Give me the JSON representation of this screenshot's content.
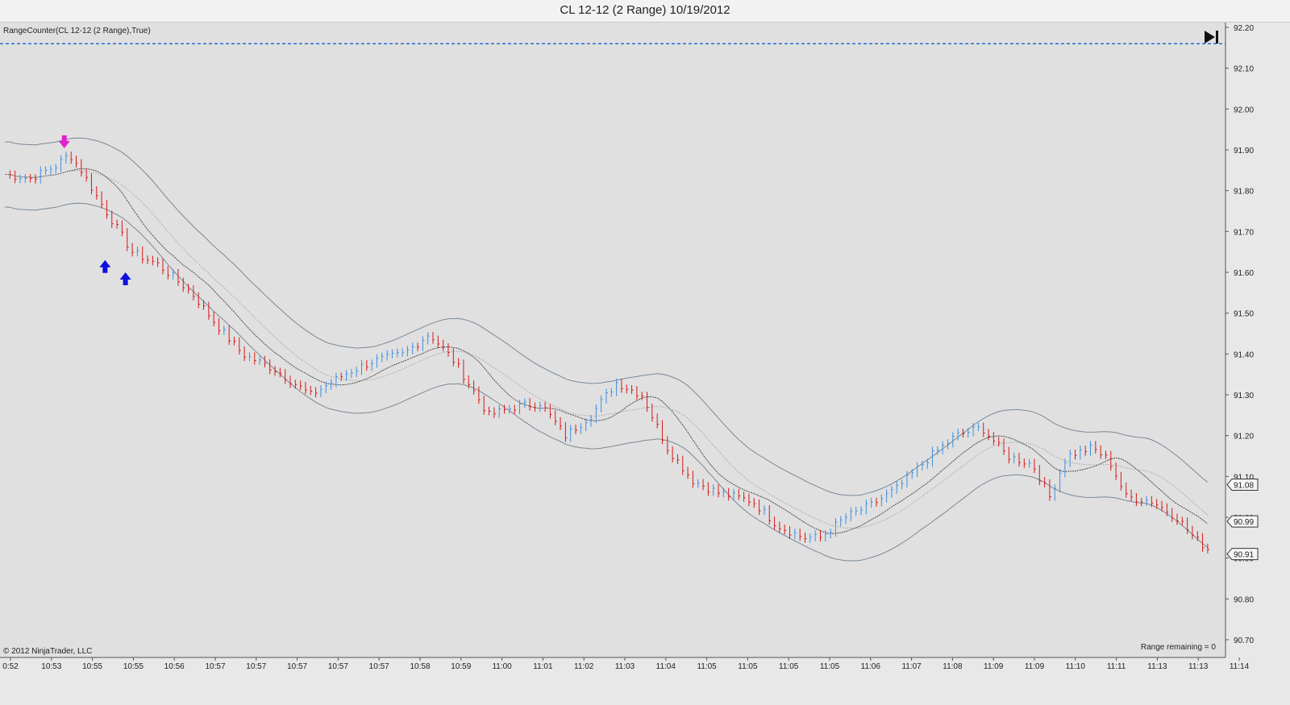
{
  "window": {
    "title": "CL 12-12 (2 Range)  10/19/2012"
  },
  "indicator_label": "RangeCounter(CL 12-12 (2 Range),True)",
  "copyright": "© 2012 NinjaTrader, LLC",
  "range_remaining": "Range remaining = 0",
  "colors": {
    "background": "#e0e0e0",
    "up_bar": "#3d8fe0",
    "down_bar": "#d81818",
    "envelope": "#7a8896",
    "midline": "#4a4a4a",
    "dashed_level": "#1f6fcf",
    "sell_arrow": "#e020d0",
    "buy_arrow": "#1010e0"
  },
  "chart_data": {
    "type": "range-bar",
    "title": "CL 12-12 (2 Range)  10/19/2012",
    "ylim": [
      90.7,
      92.2
    ],
    "y_ticks": [
      92.2,
      92.1,
      92.0,
      91.9,
      91.8,
      91.7,
      91.6,
      91.5,
      91.4,
      91.3,
      91.2,
      91.1,
      91.0,
      90.9,
      90.8,
      90.7
    ],
    "x_tick_labels": [
      "0:52",
      "10:53",
      "10:55",
      "10:55",
      "10:56",
      "10:57",
      "10:57",
      "10:57",
      "10:57",
      "10:57",
      "10:58",
      "10:59",
      "11:00",
      "11:01",
      "11:02",
      "11:03",
      "11:04",
      "11:05",
      "11:05",
      "11:05",
      "11:05",
      "11:06",
      "11:07",
      "11:08",
      "11:09",
      "11:09",
      "11:10",
      "11:11",
      "11:13",
      "11:13",
      "11:14"
    ],
    "price_markers": [
      {
        "label": "91.08",
        "value": 91.08
      },
      {
        "label": "90.99",
        "value": 90.99
      },
      {
        "label": "90.91",
        "value": 90.91
      }
    ],
    "dashed_level": 92.16,
    "close_path": [
      [
        0,
        91.84
      ],
      [
        15,
        91.83
      ],
      [
        30,
        91.86
      ],
      [
        38,
        91.89
      ],
      [
        45,
        91.85
      ],
      [
        55,
        91.78
      ],
      [
        75,
        91.65
      ],
      [
        90,
        91.62
      ],
      [
        110,
        91.55
      ],
      [
        125,
        91.47
      ],
      [
        140,
        91.4
      ],
      [
        160,
        91.36
      ],
      [
        180,
        91.3
      ],
      [
        200,
        91.35
      ],
      [
        215,
        91.38
      ],
      [
        235,
        91.4
      ],
      [
        250,
        91.45
      ],
      [
        265,
        91.38
      ],
      [
        285,
        91.25
      ],
      [
        300,
        91.27
      ],
      [
        315,
        91.28
      ],
      [
        330,
        91.2
      ],
      [
        345,
        91.25
      ],
      [
        360,
        91.33
      ],
      [
        375,
        91.3
      ],
      [
        390,
        91.17
      ],
      [
        405,
        91.09
      ],
      [
        420,
        91.06
      ],
      [
        440,
        91.04
      ],
      [
        455,
        90.98
      ],
      [
        470,
        90.95
      ],
      [
        480,
        90.95
      ],
      [
        495,
        91.0
      ],
      [
        510,
        91.03
      ],
      [
        525,
        91.07
      ],
      [
        545,
        91.15
      ],
      [
        560,
        91.2
      ],
      [
        575,
        91.22
      ],
      [
        590,
        91.15
      ],
      [
        605,
        91.13
      ],
      [
        615,
        91.05
      ],
      [
        625,
        91.15
      ],
      [
        640,
        91.17
      ],
      [
        650,
        91.14
      ],
      [
        660,
        91.05
      ],
      [
        675,
        91.04
      ],
      [
        690,
        91.0
      ],
      [
        700,
        90.95
      ],
      [
        709,
        90.92
      ]
    ],
    "buy_signals": [
      {
        "x": 59,
        "price": 91.63
      },
      {
        "x": 71,
        "price": 91.6
      }
    ],
    "sell_signals": [
      {
        "x": 35,
        "price": 91.9
      }
    ],
    "grid": false
  }
}
